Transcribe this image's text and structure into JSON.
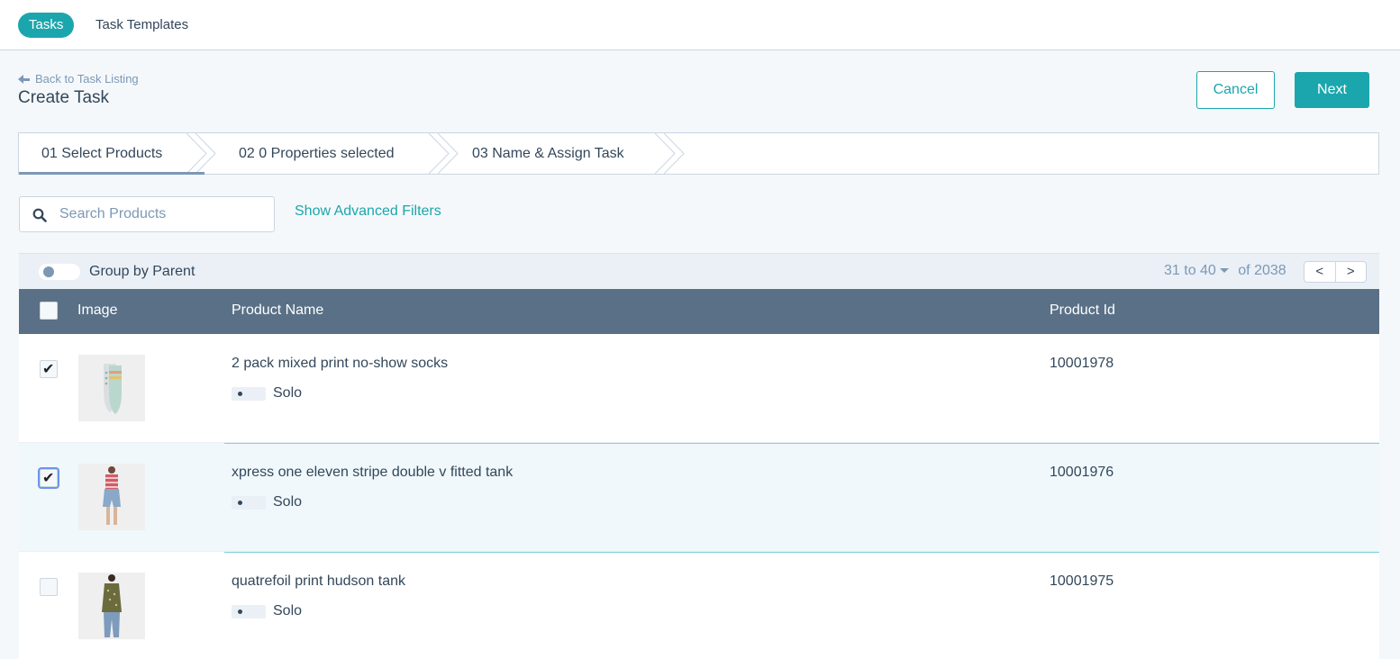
{
  "top_tabs": [
    {
      "label": "Tasks",
      "active": true
    },
    {
      "label": "Task Templates",
      "active": false
    }
  ],
  "header": {
    "back_label": "Back to Task Listing",
    "title": "Create Task",
    "cancel_label": "Cancel",
    "next_label": "Next"
  },
  "steps": [
    {
      "label": "01 Select Products",
      "active": true
    },
    {
      "label": "02 0 Properties selected",
      "active": false
    },
    {
      "label": "03 Name & Assign Task",
      "active": false
    }
  ],
  "search": {
    "placeholder": "Search Products",
    "value": "",
    "advanced_filters_label": "Show Advanced Filters"
  },
  "group_bar": {
    "toggle_label": "Group by Parent",
    "toggle_on": false,
    "range_label": "31 to 40",
    "total_label": "of 2038",
    "prev_label": "<",
    "next_label": ">"
  },
  "table": {
    "columns": [
      "Image",
      "Product Name",
      "Product Id"
    ],
    "rows": [
      {
        "name": "2 pack mixed print no-show socks",
        "tag": "Solo",
        "id": "10001978",
        "checked": true,
        "image": "socks-image"
      },
      {
        "name": "xpress one eleven stripe double v fitted tank",
        "tag": "Solo",
        "id": "10001976",
        "checked": true,
        "image": "striped-tank-image"
      },
      {
        "name": "quatrefoil print hudson tank",
        "tag": "Solo",
        "id": "10001975",
        "checked": false,
        "image": "print-tank-image"
      }
    ]
  },
  "colors": {
    "accent": "#1ba6ad",
    "table_header": "#5a7086",
    "group_bar": "#eaf0f6"
  }
}
